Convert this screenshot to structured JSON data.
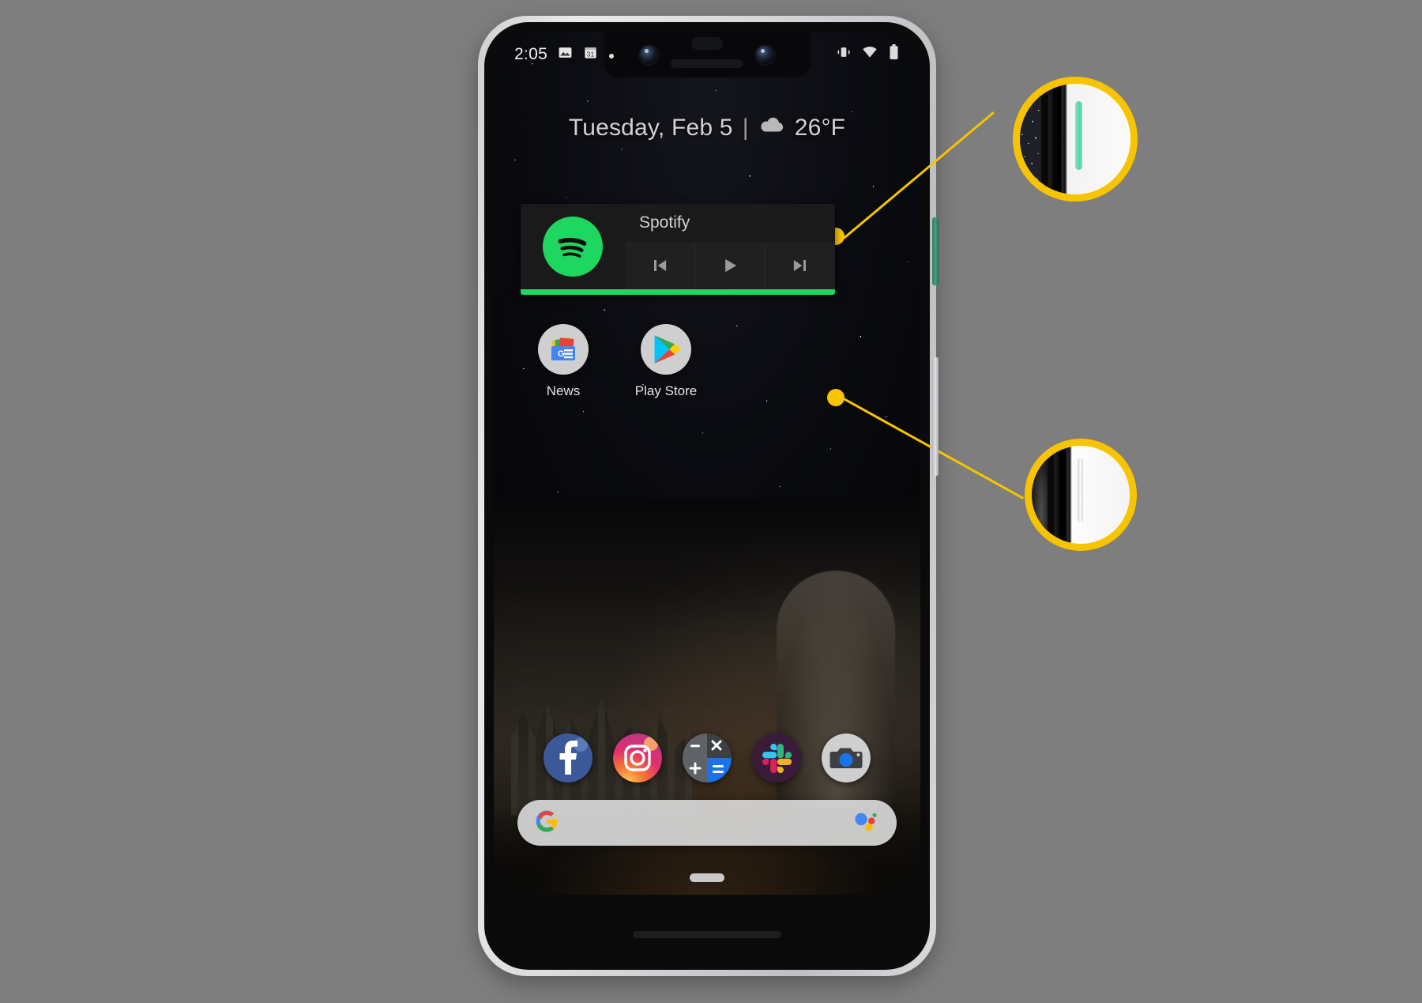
{
  "page": {
    "background_color": "#7e7e7e",
    "accent_color": "#f8c400"
  },
  "phone": {
    "device_name": "Pixel 3 XL",
    "frame_color": "#d6d7d9",
    "side_buttons": [
      {
        "name": "power-button",
        "label": "Power button",
        "color": "#45a383"
      },
      {
        "name": "volume-button",
        "label": "Volume rocker",
        "color": "#e2e4e6"
      }
    ]
  },
  "status_bar": {
    "clock": "2:05",
    "left_icons": [
      {
        "name": "photos-icon",
        "label": "Photos"
      },
      {
        "name": "calendar-icon",
        "label": "31"
      },
      {
        "name": "notification-dot-icon",
        "label": "More notifications"
      }
    ],
    "right_icons": [
      {
        "name": "vibrate-icon",
        "label": "Vibrate"
      },
      {
        "name": "wifi-icon",
        "label": "Wi-Fi"
      },
      {
        "name": "battery-icon",
        "label": "Battery"
      }
    ]
  },
  "date_weather": {
    "date": "Tuesday, Feb 5",
    "divider": "|",
    "weather_icon": "cloud-icon",
    "temperature": "26°F"
  },
  "spotify_widget": {
    "app_name": "Spotify",
    "logo_icon": "spotify-icon",
    "logo_color": "#1ed760",
    "progress_color": "#1ed760",
    "controls": [
      {
        "name": "previous-track-button",
        "label": "Previous"
      },
      {
        "name": "play-button",
        "label": "Play"
      },
      {
        "name": "next-track-button",
        "label": "Next"
      }
    ]
  },
  "app_grid": [
    {
      "name": "news",
      "label": "News",
      "icon": "google-news-icon"
    },
    {
      "name": "play-store",
      "label": "Play Store",
      "icon": "play-store-icon"
    }
  ],
  "dock": [
    {
      "name": "facebook",
      "label": "Facebook",
      "icon": "facebook-icon"
    },
    {
      "name": "instagram",
      "label": "Instagram",
      "icon": "instagram-icon"
    },
    {
      "name": "calculator",
      "label": "Calculator",
      "icon": "calculator-icon"
    },
    {
      "name": "slack",
      "label": "Slack",
      "icon": "slack-icon"
    },
    {
      "name": "camera",
      "label": "Camera",
      "icon": "camera-icon"
    }
  ],
  "search_bar": {
    "value": "",
    "placeholder": "",
    "left_icon": "google-g-icon",
    "right_icon": "google-assistant-icon"
  },
  "navigation": {
    "home_pill": "home-gesture-pill"
  },
  "callouts": [
    {
      "name": "callout-power-button",
      "target": "Power button",
      "marker_color": "#f8c400",
      "detail": "Green power button on right edge"
    },
    {
      "name": "callout-volume-button",
      "target": "Volume rocker",
      "marker_color": "#f8c400",
      "detail": "Silver volume rocker on right edge"
    }
  ]
}
